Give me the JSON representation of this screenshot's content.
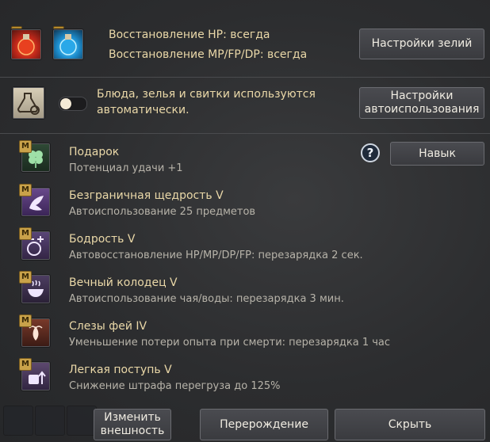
{
  "potions": {
    "hp_recovery": "Восстановление HP: всегда",
    "mp_recovery": "Восстановление MP/FP/DP: всегда",
    "settings_button": "Настройки зелий"
  },
  "auto_use": {
    "description_line1": "Блюда, зелья и свитки используются",
    "description_line2": "автоматически.",
    "settings_button_line1": "Настройки",
    "settings_button_line2": "автоиспользования"
  },
  "skill_button": "Навык",
  "help_symbol": "?",
  "badge_letter": "M",
  "buffs": [
    {
      "title": "Подарок",
      "description": "Потенциал удачи +1",
      "icon": "clover-icon"
    },
    {
      "title": "Безграничная щедрость V",
      "description": "Автоиспользование 25 предметов",
      "icon": "fairy-icon"
    },
    {
      "title": "Бодрость V",
      "description": "Автовосстановление HP/MP/DP/FP: перезарядка 2 сек.",
      "icon": "potion-plus-icon"
    },
    {
      "title": "Вечный колодец V",
      "description": "Автоиспользование чая/воды: перезарядка 3 мин.",
      "icon": "bowl-icon"
    },
    {
      "title": "Слезы фей IV",
      "description": "Уменьшение потери опыта при смерти: перезарядка 1 час",
      "icon": "fairy-tears-icon"
    },
    {
      "title": "Легкая поступь V",
      "description": "Снижение штрафа перегруза до 125%",
      "icon": "bag-arrow-icon"
    }
  ],
  "footer": {
    "change_appearance_line1": "Изменить",
    "change_appearance_line2": "внешность",
    "rebirth_button": "Перерождение",
    "hide_button": "Скрыть"
  }
}
